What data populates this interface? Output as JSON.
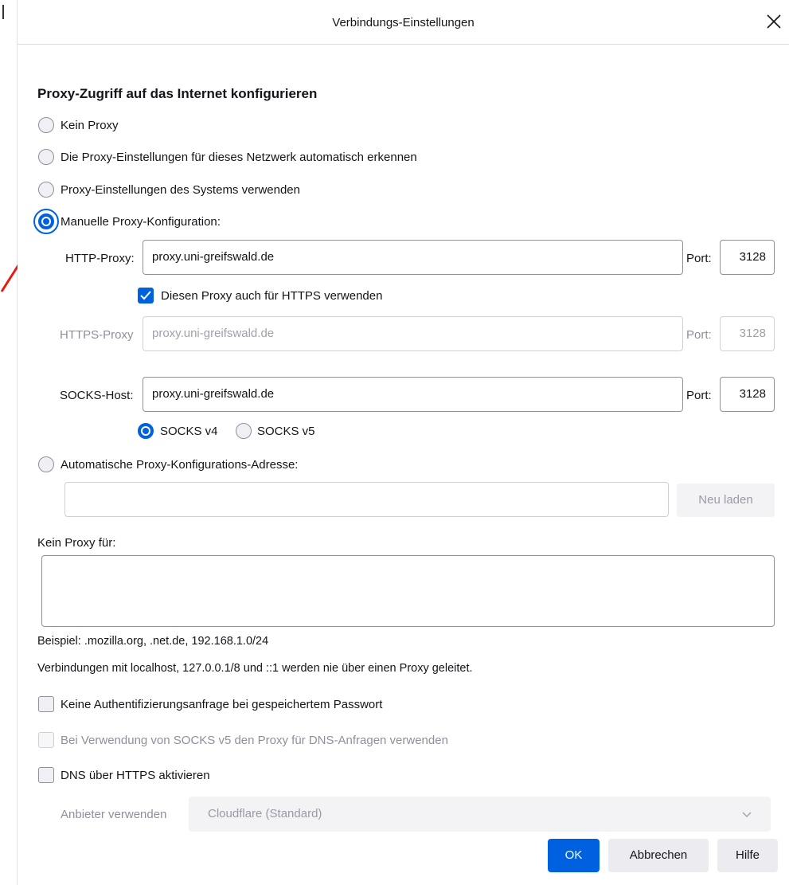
{
  "dialog": {
    "title": "Verbindungs-Einstellungen"
  },
  "proxy": {
    "heading": "Proxy-Zugriff auf das Internet konfigurieren",
    "options": {
      "none": "Kein Proxy",
      "auto_detect": "Die Proxy-Einstellungen für dieses Netzwerk automatisch erkennen",
      "system": "Proxy-Einstellungen des Systems verwenden",
      "manual": "Manuelle Proxy-Konfiguration:",
      "pac": "Automatische Proxy-Konfigurations-Adresse:"
    },
    "selected": "manual",
    "http": {
      "label": "HTTP-Proxy:",
      "value": "proxy.uni-greifswald.de",
      "port_label": "Port:",
      "port": "3128"
    },
    "use_for_https": {
      "label": "Diesen Proxy auch für HTTPS verwenden",
      "checked": true
    },
    "https": {
      "label": "HTTPS-Proxy",
      "value": "proxy.uni-greifswald.de",
      "port_label": "Port:",
      "port": "3128"
    },
    "socks": {
      "label": "SOCKS-Host:",
      "value": "proxy.uni-greifswald.de",
      "port_label": "Port:",
      "port": "3128",
      "v4_label": "SOCKS v4",
      "v5_label": "SOCKS v5",
      "version_selected": "v4"
    },
    "pac": {
      "url": "",
      "reload_label": "Neu laden"
    }
  },
  "no_proxy": {
    "label": "Kein Proxy für:",
    "value": "",
    "example": "Beispiel: .mozilla.org, .net.de, 192.168.1.0/24",
    "note": "Verbindungen mit localhost, 127.0.0.1/8 und ::1 werden nie über einen Proxy geleitet."
  },
  "checkboxes": {
    "no_auth_prompt": {
      "label": "Keine Authentifizierungsanfrage bei gespeichertem Passwort",
      "checked": false
    },
    "socks_dns": {
      "label": "Bei Verwendung von SOCKS v5 den Proxy für DNS-Anfragen verwenden",
      "checked": false,
      "disabled": true
    },
    "doh": {
      "label": "DNS über HTTPS aktivieren",
      "checked": false
    }
  },
  "doh_provider": {
    "label": "Anbieter verwenden",
    "value": "Cloudflare (Standard)"
  },
  "buttons": {
    "ok": "OK",
    "cancel": "Abbrechen",
    "help": "Hilfe"
  },
  "colors": {
    "accent": "#0061e0",
    "arrow": "#e8190f"
  }
}
